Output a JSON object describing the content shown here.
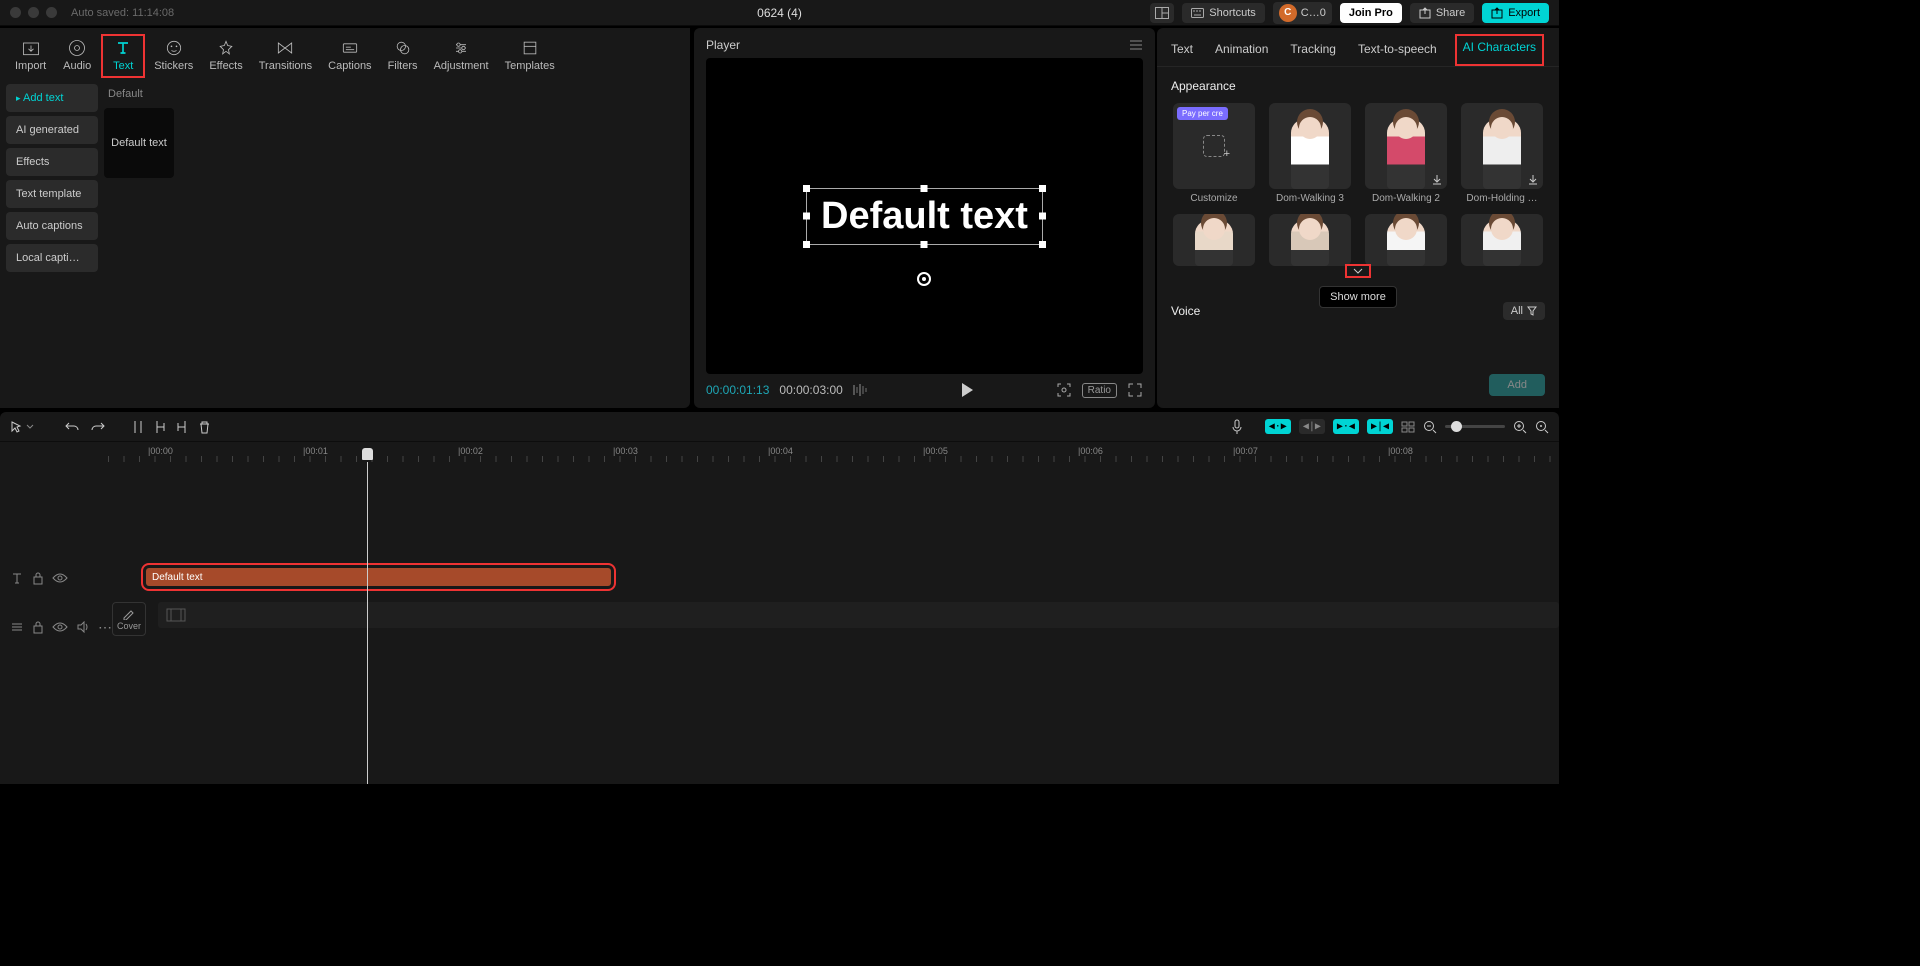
{
  "titlebar": {
    "autosave": "Auto saved: 11:14:08",
    "project": "0624 (4)",
    "shortcuts": "Shortcuts",
    "user_letter": "C",
    "user_label": "C…0",
    "join": "Join Pro",
    "share": "Share",
    "export": "Export"
  },
  "toolbar": {
    "items": [
      "Import",
      "Audio",
      "Text",
      "Stickers",
      "Effects",
      "Transitions",
      "Captions",
      "Filters",
      "Adjustment",
      "Templates"
    ],
    "active_index": 2
  },
  "sidebar": {
    "items": [
      "Add text",
      "AI generated",
      "Effects",
      "Text template",
      "Auto captions",
      "Local capti…"
    ],
    "active_index": 0
  },
  "assets": {
    "heading": "Default",
    "card": "Default text"
  },
  "player": {
    "title": "Player",
    "text": "Default text",
    "current": "00:00:01:13",
    "total": "00:00:03:00",
    "ratio": "Ratio"
  },
  "right_tabs": {
    "items": [
      "Text",
      "Animation",
      "Tracking",
      "Text-to-speech",
      "AI Characters"
    ],
    "active_index": 4
  },
  "appearance": {
    "title": "Appearance",
    "pay_badge": "Pay per cre",
    "items_row1": [
      "Customize",
      "Dom-Walking 3",
      "Dom-Walking 2",
      "Dom-Holding …"
    ],
    "show_more": "Show more"
  },
  "voice": {
    "title": "Voice",
    "all": "All"
  },
  "add_button": "Add",
  "timeline": {
    "marks": [
      "|00:00",
      "|00:01",
      "|00:02",
      "|00:03",
      "|00:04",
      "|00:05",
      "|00:06",
      "|00:07",
      "|00:08"
    ],
    "clip_label": "Default text",
    "cover": "Cover"
  }
}
